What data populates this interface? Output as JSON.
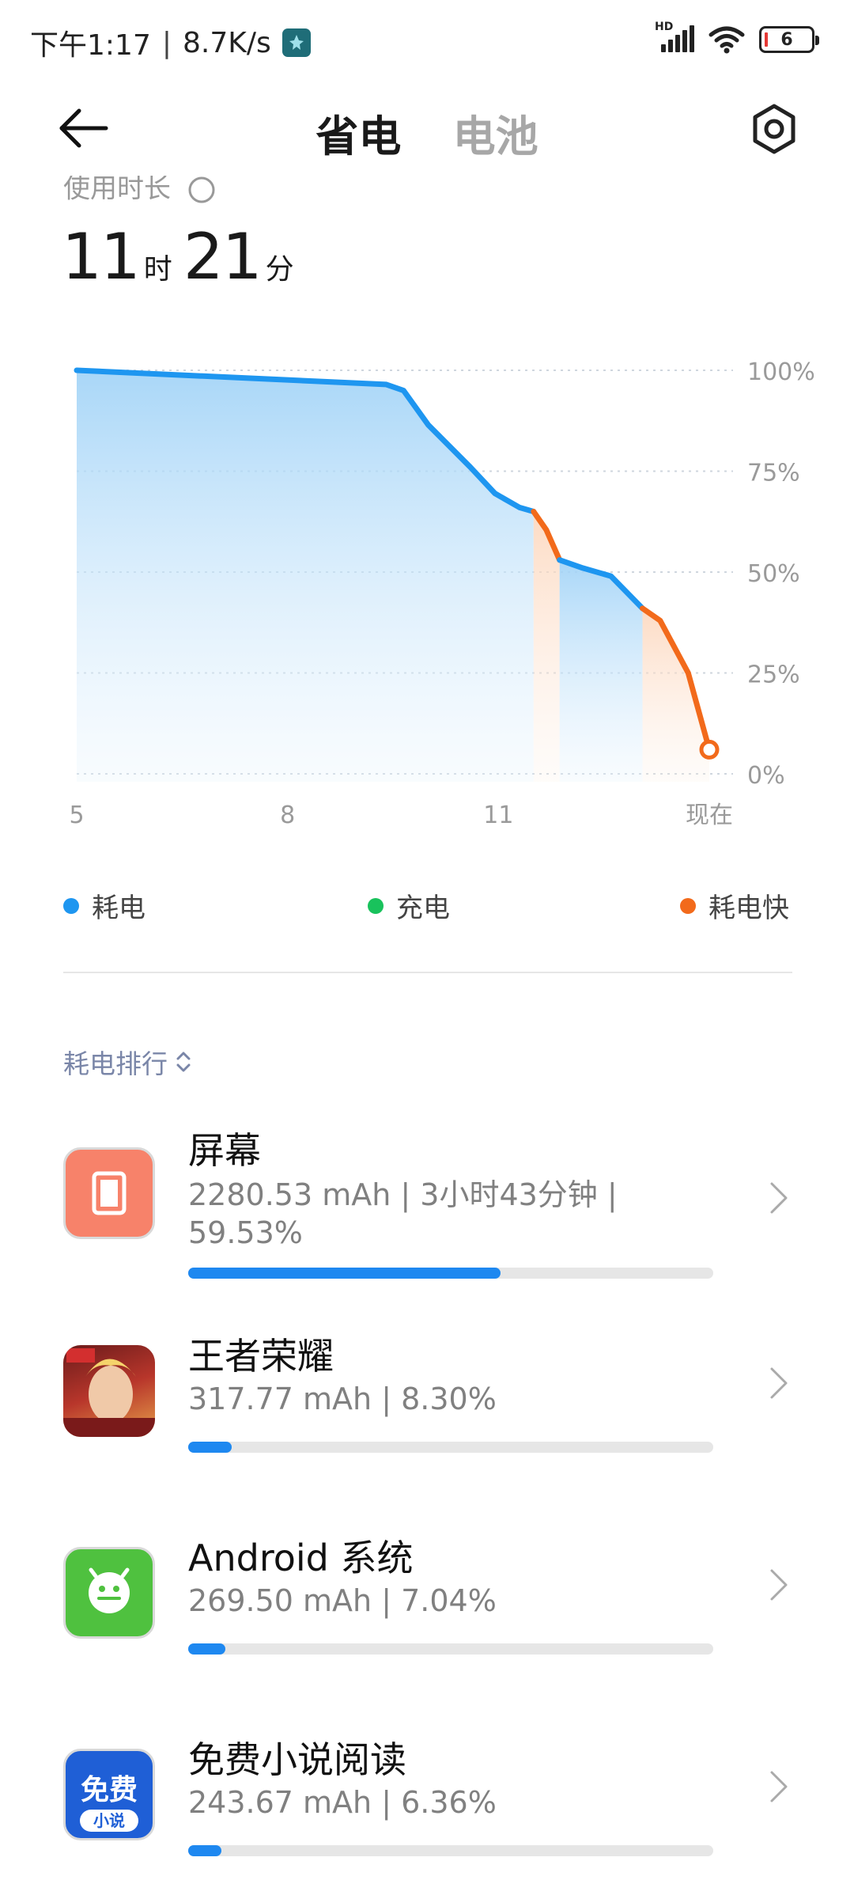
{
  "status_bar": {
    "time": "下午1:17",
    "separator": "|",
    "net_speed": "8.7K/s",
    "battery_level": "6"
  },
  "header": {
    "back_icon": "arrow-left-icon",
    "tabs": [
      {
        "label": "省电",
        "active": true
      },
      {
        "label": "电池",
        "active": false
      }
    ],
    "settings_icon": "gear-icon"
  },
  "usage": {
    "label": "使用时长",
    "hours": "11",
    "hours_unit": "时",
    "minutes": "21",
    "minutes_unit": "分"
  },
  "chart_data": {
    "type": "line",
    "x_tick_labels": [
      "5",
      "8",
      "11",
      "现在"
    ],
    "x_ticks": [
      5,
      8,
      11,
      14
    ],
    "y_tick_labels": [
      "100%",
      "75%",
      "50%",
      "25%",
      "0%"
    ],
    "ylim": [
      0,
      100
    ],
    "xlim": [
      5,
      14
    ],
    "series": [
      {
        "name": "耗电",
        "color": "#1e96f0",
        "points": [
          [
            5,
            100
          ],
          [
            9.4,
            96.5
          ],
          [
            9.65,
            95
          ],
          [
            10,
            86.5
          ],
          [
            10.6,
            76
          ],
          [
            10.95,
            69.5
          ],
          [
            11.3,
            66
          ],
          [
            11.5,
            65
          ]
        ]
      },
      {
        "name": "耗电快",
        "color": "#f26a1b",
        "points": [
          [
            11.5,
            65
          ],
          [
            11.68,
            60.5
          ],
          [
            11.87,
            53
          ]
        ]
      },
      {
        "name": "耗电",
        "color": "#1e96f0",
        "points": [
          [
            11.87,
            53
          ],
          [
            12.2,
            51
          ],
          [
            12.6,
            49
          ],
          [
            13.05,
            41
          ]
        ]
      },
      {
        "name": "耗电快",
        "color": "#f26a1b",
        "points": [
          [
            13.05,
            41
          ],
          [
            13.3,
            38
          ],
          [
            13.7,
            25
          ],
          [
            14,
            6
          ]
        ]
      }
    ],
    "current_point": [
      14,
      6
    ]
  },
  "legend": [
    {
      "label": "耗电",
      "color": "#1e96f0"
    },
    {
      "label": "充电",
      "color": "#19c25c"
    },
    {
      "label": "耗电快",
      "color": "#f26a1b"
    }
  ],
  "ranking": {
    "sort_label": "耗电排行"
  },
  "apps": [
    {
      "name": "屏幕",
      "stats": "2280.53 mAh | 3小时43分钟 | 59.53%",
      "percent": 59.53,
      "icon": "screen-icon"
    },
    {
      "name": "王者荣耀",
      "stats": "317.77 mAh | 8.30%",
      "percent": 8.3,
      "icon": "honor-of-kings-icon"
    },
    {
      "name": "Android 系统",
      "stats": "269.50 mAh | 7.04%",
      "percent": 7.04,
      "icon": "android-robot-icon"
    },
    {
      "name": "免费小说阅读",
      "stats": "243.67 mAh | 6.36%",
      "percent": 6.36,
      "icon": "novel-reader-icon",
      "icon_text_main": "免费",
      "icon_text_sub": "小说"
    }
  ]
}
